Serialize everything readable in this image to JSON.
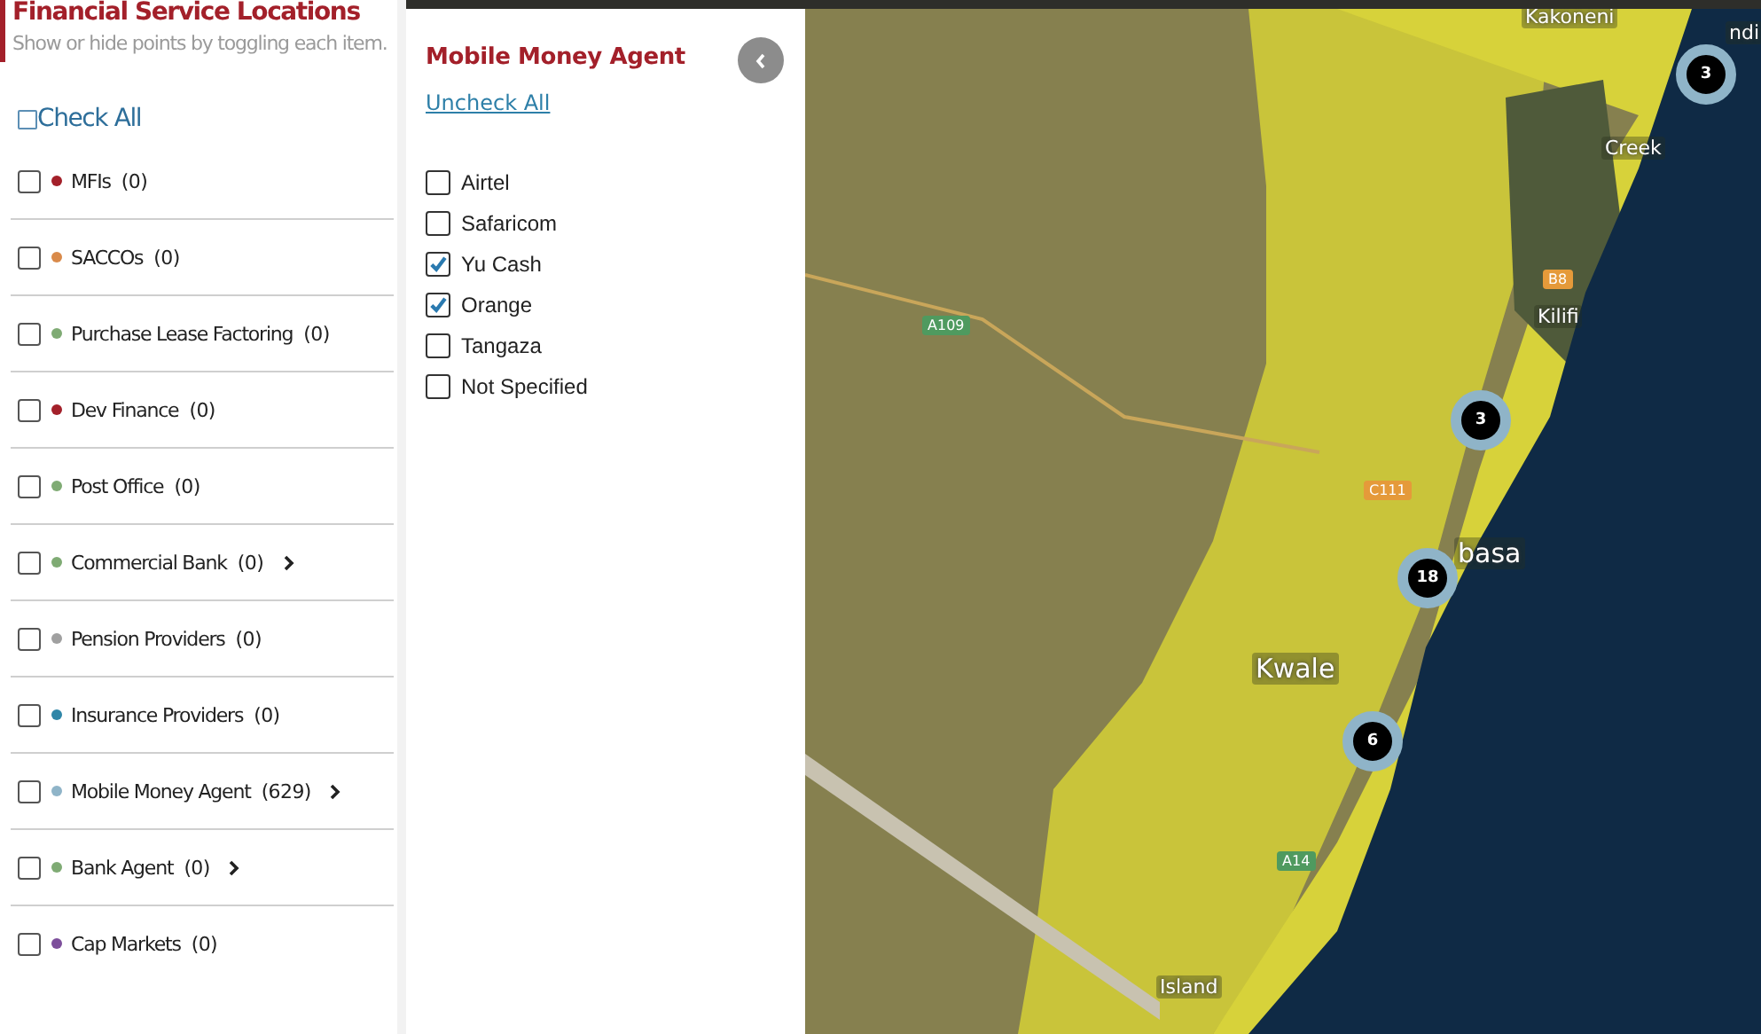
{
  "sidebar": {
    "title": "Financial Service Locations",
    "subtitle": "Show or hide points by toggling each item.",
    "check_all": {
      "label": "Check All",
      "checked": false
    },
    "items": [
      {
        "label": "MFIs",
        "count": "(0)",
        "color": "#a3202a",
        "checked": false,
        "expandable": false
      },
      {
        "label": "SACCOs",
        "count": "(0)",
        "color": "#d98a4a",
        "checked": false,
        "expandable": false
      },
      {
        "label": "Purchase Lease Factoring",
        "count": "(0)",
        "color": "#7fab74",
        "checked": false,
        "expandable": false
      },
      {
        "label": "Dev Finance",
        "count": "(0)",
        "color": "#a3202a",
        "checked": false,
        "expandable": false
      },
      {
        "label": "Post Office",
        "count": "(0)",
        "color": "#7fab74",
        "checked": false,
        "expandable": false
      },
      {
        "label": "Commercial Bank",
        "count": "(0)",
        "color": "#7fab74",
        "checked": false,
        "expandable": true
      },
      {
        "label": "Pension Providers",
        "count": "(0)",
        "color": "#a0a0a0",
        "checked": false,
        "expandable": false
      },
      {
        "label": "Insurance Providers",
        "count": "(0)",
        "color": "#2f86a8",
        "checked": false,
        "expandable": false
      },
      {
        "label": "Mobile Money Agent",
        "count": "(629)",
        "color": "#8fb4c8",
        "checked": false,
        "expandable": true
      },
      {
        "label": "Bank Agent",
        "count": "(0)",
        "color": "#7fab74",
        "checked": false,
        "expandable": true
      },
      {
        "label": "Cap Markets",
        "count": "(0)",
        "color": "#7d4f9b",
        "checked": false,
        "expandable": false
      }
    ]
  },
  "subpanel": {
    "title": "Mobile Money Agent",
    "uncheck_all": "Uncheck All",
    "options": [
      {
        "label": "Airtel",
        "checked": false
      },
      {
        "label": "Safaricom",
        "checked": false
      },
      {
        "label": "Yu Cash",
        "checked": true
      },
      {
        "label": "Orange",
        "checked": true
      },
      {
        "label": "Tangaza",
        "checked": false
      },
      {
        "label": "Not Specified",
        "checked": false
      }
    ]
  },
  "map": {
    "places": [
      {
        "label": "Kakoneni",
        "kind": "town"
      },
      {
        "label": "ndi",
        "kind": "town"
      },
      {
        "label": "Creek",
        "kind": "town"
      },
      {
        "label": "Kilifi",
        "kind": "town"
      },
      {
        "label": "basa",
        "kind": "city"
      },
      {
        "label": "Kwale",
        "kind": "city"
      },
      {
        "label": "Island",
        "kind": "town"
      }
    ],
    "roads": [
      {
        "label": "A109",
        "kind": "green"
      },
      {
        "label": "B8",
        "kind": "orange"
      },
      {
        "label": "C111",
        "kind": "orange"
      },
      {
        "label": "A14",
        "kind": "green"
      }
    ],
    "clusters": [
      {
        "count": "3"
      },
      {
        "count": "3"
      },
      {
        "count": "18"
      },
      {
        "count": "6"
      }
    ]
  }
}
